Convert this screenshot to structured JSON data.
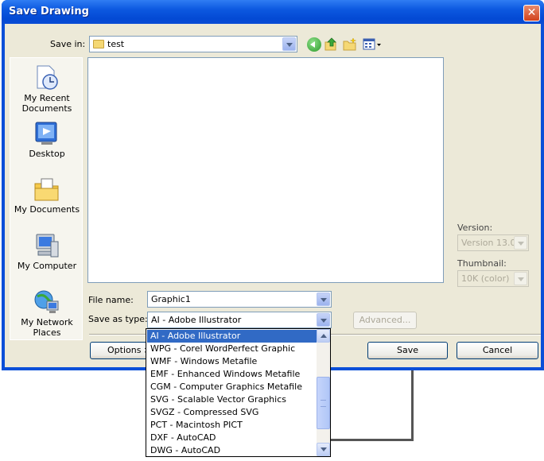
{
  "window": {
    "title": "Save Drawing",
    "close_glyph": "✕"
  },
  "save_in": {
    "label": "Save in:",
    "value": "test"
  },
  "places": [
    {
      "label_lines": [
        "My Recent",
        "Documents"
      ],
      "icon": "recent-documents-icon"
    },
    {
      "label_lines": [
        "Desktop"
      ],
      "icon": "desktop-icon"
    },
    {
      "label_lines": [
        "My Documents"
      ],
      "icon": "my-documents-icon"
    },
    {
      "label_lines": [
        "My Computer"
      ],
      "icon": "my-computer-icon"
    },
    {
      "label_lines": [
        "My Network",
        "Places"
      ],
      "icon": "network-places-icon"
    }
  ],
  "version": {
    "label": "Version:",
    "value": "Version 13.0"
  },
  "thumbnail": {
    "label": "Thumbnail:",
    "value": "10K (color)"
  },
  "file_name": {
    "label": "File name:",
    "value": "Graphic1"
  },
  "save_as_type": {
    "label": "Save as type:",
    "value": "AI - Adobe Illustrator",
    "options": [
      "AI - Adobe Illustrator",
      "WPG - Corel WordPerfect Graphic",
      "WMF - Windows Metafile",
      "EMF - Enhanced Windows Metafile",
      "CGM - Computer Graphics Metafile",
      "SVG - Scalable Vector Graphics",
      "SVGZ - Compressed SVG",
      "PCT - Macintosh PICT",
      "DXF - AutoCAD",
      "DWG - AutoCAD"
    ],
    "selected_index": 0
  },
  "buttons": {
    "advanced": "Advanced...",
    "options": "Options >",
    "save": "Save",
    "cancel": "Cancel"
  },
  "colors": {
    "title_bar": "#0a4fd8",
    "selection": "#316ac5",
    "dialog_face": "#ece9d8"
  }
}
